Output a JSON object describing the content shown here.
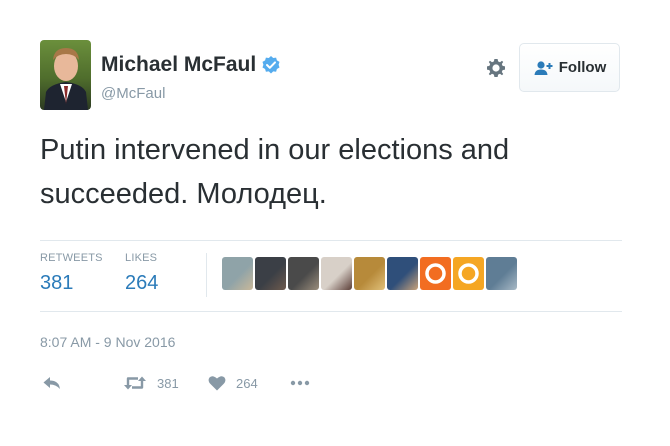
{
  "user": {
    "name": "Michael McFaul",
    "handle": "@McFaul",
    "verified_color": "#55acee"
  },
  "follow_button": {
    "label": "Follow"
  },
  "tweet": {
    "text": "Putin intervened in our elections and\nsucceeded. Молодец."
  },
  "stats": {
    "retweets_label": "RETWEETS",
    "retweets_value": "381",
    "likes_label": "LIKES",
    "likes_value": "264"
  },
  "likers": [
    {
      "colors": [
        "#8fa3a8",
        "#c9b89a"
      ]
    },
    {
      "colors": [
        "#3b3f46",
        "#6e5a4d"
      ]
    },
    {
      "colors": [
        "#4a4a4a",
        "#9a8d7c"
      ]
    },
    {
      "colors": [
        "#d8d0c8",
        "#5b3d37"
      ]
    },
    {
      "colors": [
        "#b78a3a",
        "#e0c07a"
      ]
    },
    {
      "colors": [
        "#2f4f7a",
        "#c9a27a"
      ]
    },
    {
      "colors": [
        "#f26d21",
        "#ffffff"
      ]
    },
    {
      "colors": [
        "#f5a623",
        "#ffffff"
      ]
    },
    {
      "colors": [
        "#5f7d95",
        "#a9bac6"
      ]
    }
  ],
  "timestamp": "8:07 AM - 9 Nov 2016",
  "actions": {
    "reply_icon": "reply-icon",
    "retweet_count": "381",
    "like_count": "264",
    "more_icon": "more-icon"
  },
  "colors": {
    "link_blue": "#2b7bb9",
    "muted_gray": "#8899a6",
    "text_dark": "#292f33"
  }
}
